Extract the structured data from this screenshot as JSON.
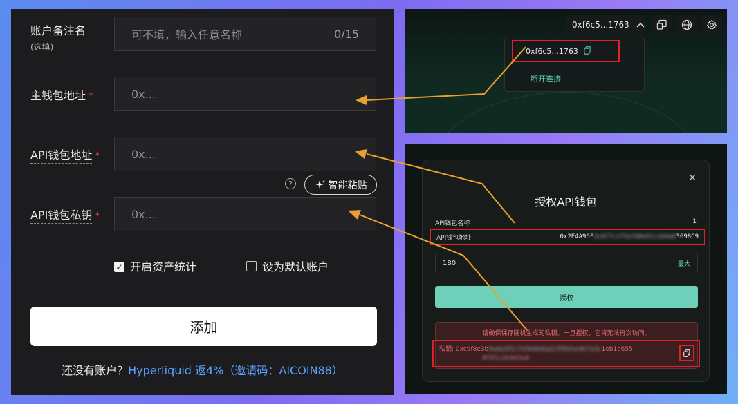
{
  "form": {
    "note_label": "账户备注名",
    "note_sub": "(选填)",
    "note_placeholder": "可不填，输入任意名称",
    "note_counter": "0/15",
    "main_wallet_label": "主钱包地址",
    "main_wallet_placeholder": "0x...",
    "api_wallet_label": "API钱包地址",
    "api_wallet_placeholder": "0x...",
    "help_glyph": "?",
    "smart_paste_label": "智能粘贴",
    "api_key_label": "API钱包私钥",
    "api_key_placeholder": "0x...",
    "required_mark": "*",
    "enable_stats_label": "开启资产统计",
    "enable_stats_checked": true,
    "default_account_label": "设为默认账户",
    "default_account_checked": false,
    "add_button": "添加",
    "footer_prefix": "还没有账户？",
    "footer_link": "Hyperliquid 返4%（邀请码：AICOIN88）"
  },
  "wallet_header": {
    "address": "0xf6c5...1763",
    "dropdown_address": "0xf6c5...1763",
    "disconnect": "断开连接",
    "icons": [
      "chevron-up-icon",
      "swap-window-icon",
      "globe-icon",
      "gear-icon",
      "copy-icon"
    ]
  },
  "auth_modal": {
    "title": "授权API钱包",
    "close_glyph": "✕",
    "name_label": "API钱包名称",
    "name_value": "1",
    "address_label": "API钱包地址",
    "address_prefix": "0x2E4A96F",
    "address_blurred": "3c6f7c1f5a7d8e91c2d4a8",
    "address_suffix": "3698C9",
    "days_value": "180",
    "max_label": "最大",
    "authorize_button": "授权",
    "warning": "请确保保存随机生成的私钥。一旦授权，它将无法再次访问。",
    "private_key_prefix": "私钥: 0xc9f8e3b",
    "private_key_blurred": "9a4e2f1c7d3b8e6a2c5f9d1e4b7a3c",
    "private_key_suffix": "1eb1e655",
    "private_key_line2": "8f3f1c2b9d3a6"
  },
  "colors": {
    "highlight_red": "#e0202a",
    "arrow_orange": "#e8a030",
    "accent_teal": "#6fd0b9",
    "link_blue": "#5aa2ff"
  }
}
